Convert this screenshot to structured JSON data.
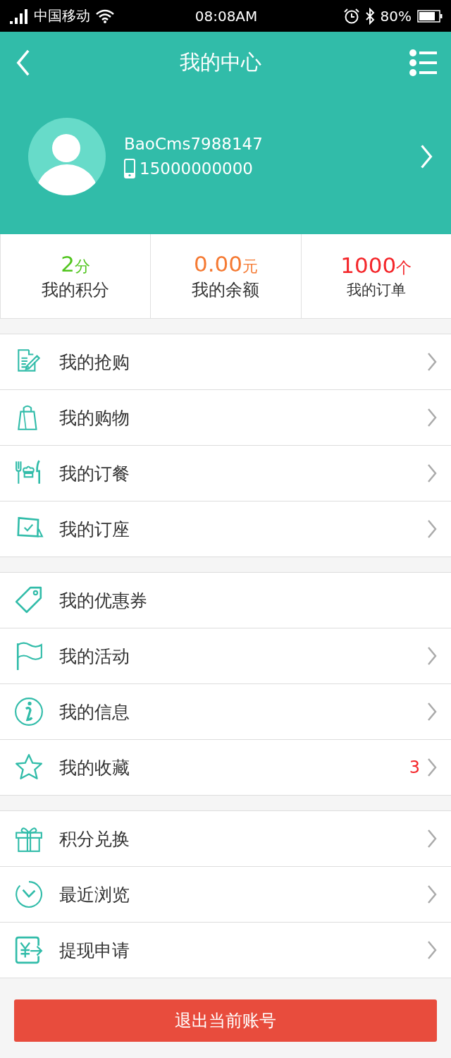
{
  "status_bar": {
    "carrier": "中国移动",
    "time": "08:08AM",
    "battery": "80%"
  },
  "nav": {
    "title": "我的中心"
  },
  "profile": {
    "username": "BaoCms7988147",
    "phone": "15000000000"
  },
  "stats": [
    {
      "value": "2",
      "unit": "分",
      "label": "我的积分",
      "color": "#52c51f"
    },
    {
      "value": "0.00",
      "unit": "元",
      "label": "我的余额",
      "color": "#f57a33"
    },
    {
      "value": "1000",
      "unit": "个",
      "label": "我的订单",
      "color": "#f4262a"
    }
  ],
  "menu_groups": [
    {
      "items": [
        {
          "label": "我的抢购",
          "chevron": true
        },
        {
          "label": "我的购物",
          "chevron": true
        },
        {
          "label": "我的订餐",
          "chevron": true
        },
        {
          "label": "我的订座",
          "chevron": true
        }
      ]
    },
    {
      "items": [
        {
          "label": "我的优惠券",
          "chevron": false
        },
        {
          "label": "我的活动",
          "chevron": true
        },
        {
          "label": "我的信息",
          "chevron": true
        },
        {
          "label": "我的收藏",
          "badge": "3",
          "chevron": true
        }
      ]
    },
    {
      "items": [
        {
          "label": "积分兑换",
          "chevron": true
        },
        {
          "label": "最近浏览",
          "chevron": true
        },
        {
          "label": "提现申请",
          "chevron": true
        }
      ]
    }
  ],
  "logout_button": "退出当前账号"
}
